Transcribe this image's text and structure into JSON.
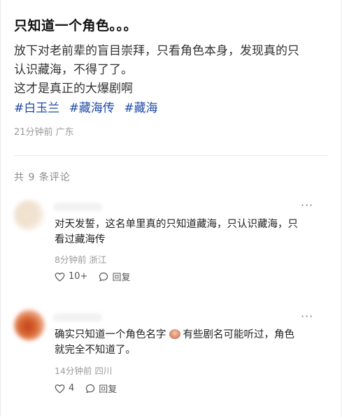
{
  "post": {
    "title": "只知道一个角色。。。",
    "body_lines": [
      "放下对老前辈的盲目崇拜，只看角色本身，发现真的只",
      "认识藏海，不得了了。",
      "这才是真正的大爆剧啊"
    ],
    "hashtags": [
      "#白玉兰",
      "#藏海传",
      "#藏海"
    ],
    "meta": "21分钟前 广东"
  },
  "comments_header": "共 9 条评论",
  "comments": [
    {
      "text_lines": [
        "对天发誓，这名单里真的只知道藏海，只认识藏海，只",
        "看过藏海传"
      ],
      "meta": "8分钟前 浙江",
      "likes": "10+",
      "reply_label": "回复",
      "more": "···"
    },
    {
      "text_line1_a": "确实只知道一个角色名字",
      "text_line1_b": "有些剧名可能听过，角色",
      "text_line2": "就完全不知道了。",
      "meta": "14分钟前 四川",
      "likes": "4",
      "reply_label": "回复",
      "more": "···"
    }
  ]
}
